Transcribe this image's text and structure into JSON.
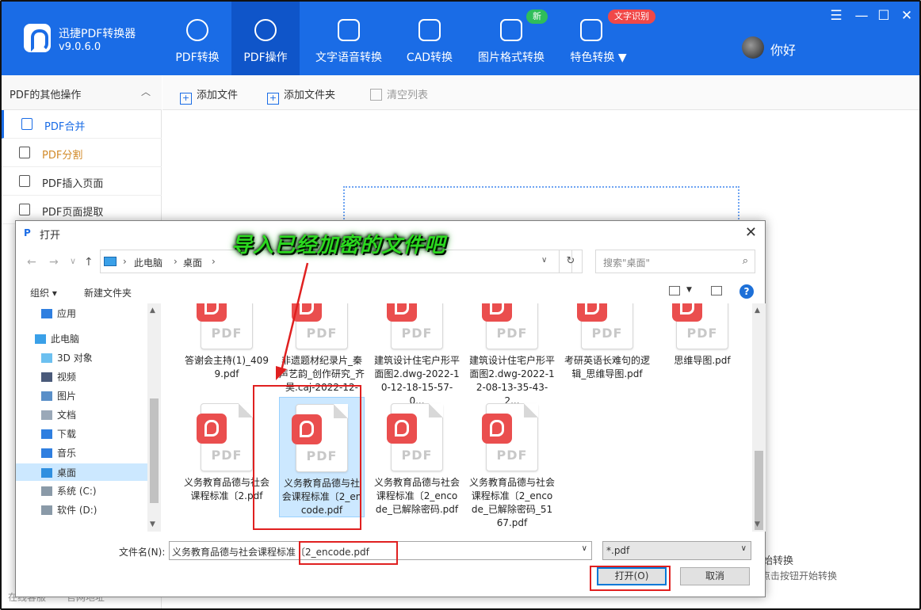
{
  "app": {
    "name": "迅捷PDF转换器",
    "version": "v9.0.6.0",
    "user": "你好"
  },
  "nav": [
    {
      "label": "PDF转换"
    },
    {
      "label": "PDF操作"
    },
    {
      "label": "文字语音转换"
    },
    {
      "label": "CAD转换"
    },
    {
      "label": "图片格式转换"
    },
    {
      "label": "特色转换 ▼"
    }
  ],
  "badges": {
    "new": "新",
    "ocr": "文字识别"
  },
  "winctl": {
    "menu": "☰",
    "min": "—",
    "max": "☐",
    "close": "✕"
  },
  "sidebar": {
    "header": "PDF的其他操作",
    "items": [
      {
        "label": "PDF合并"
      },
      {
        "label": "PDF分割"
      },
      {
        "label": "PDF插入页面"
      },
      {
        "label": "PDF页面提取"
      }
    ],
    "bottom": [
      "在线客服",
      "官网地址"
    ]
  },
  "toolbar": {
    "add_file": "添加文件",
    "add_folder": "添加文件夹",
    "clear": "清空列表"
  },
  "behind": {
    "convert": "始转换",
    "hint": "点击按钮开始转换"
  },
  "dialog": {
    "title": "打开",
    "path": [
      "此电脑",
      "桌面"
    ],
    "search_placeholder": "搜索\"桌面\"",
    "organize": "组织 ▾",
    "new_folder": "新建文件夹",
    "help": "?",
    "tree": [
      {
        "label": "应用",
        "icon": "apps-icon",
        "indent": 1
      },
      {
        "label": "此电脑",
        "icon": "computer-icon",
        "indent": 0
      },
      {
        "label": "3D 对象",
        "icon": "3d-objects-icon",
        "indent": 1
      },
      {
        "label": "视频",
        "icon": "video-icon",
        "indent": 1
      },
      {
        "label": "图片",
        "icon": "pictures-icon",
        "indent": 1
      },
      {
        "label": "文档",
        "icon": "documents-icon",
        "indent": 1
      },
      {
        "label": "下载",
        "icon": "download-icon",
        "indent": 1
      },
      {
        "label": "音乐",
        "icon": "music-icon",
        "indent": 1
      },
      {
        "label": "桌面",
        "icon": "desktop-icon",
        "indent": 1,
        "selected": true
      },
      {
        "label": "系统 (C:)",
        "icon": "drive-icon",
        "indent": 1
      },
      {
        "label": "软件 (D:)",
        "icon": "drive-icon",
        "indent": 1
      }
    ],
    "files_row1": [
      {
        "name": "答谢会主持(1)_4099.pdf"
      },
      {
        "name": "非遗题材纪录片_秦声艺韵_创作研究_齐昊.caj-2022-12-0..."
      },
      {
        "name": "建筑设计住宅户形平面图2.dwg-2022-10-12-18-15-57-0..."
      },
      {
        "name": "建筑设计住宅户形平面图2.dwg-2022-12-08-13-35-43-2..."
      },
      {
        "name": "考研英语长难句的逻辑_思维导图.pdf"
      },
      {
        "name": "思维导图.pdf"
      }
    ],
    "files_row2": [
      {
        "name": "义务教育品德与社会课程标准〔2.pdf"
      },
      {
        "name": "义务教育品德与社会课程标准〔2_encode.pdf",
        "selected": true
      },
      {
        "name": "义务教育品德与社会课程标准〔2_encode_已解除密码.pdf"
      },
      {
        "name": "义务教育品德与社会课程标准〔2_encode_已解除密码_5167.pdf"
      }
    ],
    "pdf_label": "PDF",
    "filename_label": "文件名(N):",
    "filename_value": "义务教育品德与社会课程标准〔2_encode.pdf",
    "filetype": "*.pdf",
    "open": "打开(O)",
    "cancel": "取消"
  },
  "annotation": "导入已经加密的文件吧",
  "colors": {
    "brand": "#1a6ce6",
    "annotation": "#2bd91f",
    "highlight": "#e02020"
  }
}
